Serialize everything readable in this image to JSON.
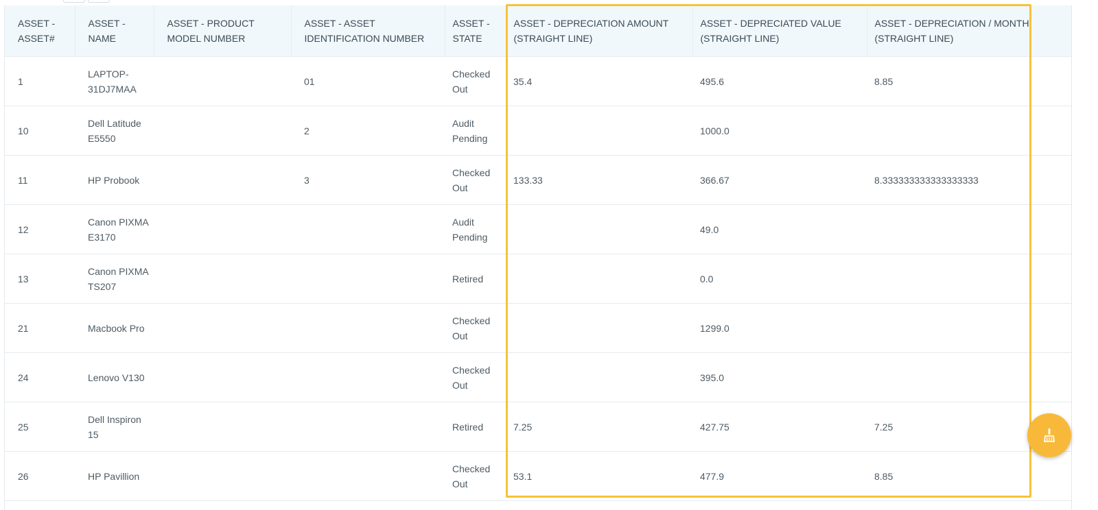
{
  "table": {
    "headers": [
      "ASSET - ASSET#",
      "ASSET - NAME",
      "ASSET - PRODUCT MODEL NUMBER",
      "ASSET - ASSET IDENTIFICATION NUMBER",
      "ASSET - STATE",
      "ASSET - DEPRECIATION AMOUNT (STRAIGHT LINE)",
      "ASSET - DEPRECIATED VALUE (STRAIGHT LINE)",
      "ASSET - DEPRECIATION / MONTH (STRAIGHT LINE)"
    ],
    "rows": [
      [
        "1",
        "LAPTOP-31DJ7MAA",
        "",
        "01",
        "Checked Out",
        "35.4",
        "495.6",
        "8.85"
      ],
      [
        "10",
        "Dell Latitude E5550",
        "",
        "2",
        "Audit Pending",
        "",
        "1000.0",
        ""
      ],
      [
        "11",
        "HP Probook",
        "",
        "3",
        "Checked Out",
        "133.33",
        "366.67",
        "8.333333333333333333"
      ],
      [
        "12",
        "Canon PIXMA E3170",
        "",
        "",
        "Audit Pending",
        "",
        "49.0",
        ""
      ],
      [
        "13",
        "Canon PIXMA TS207",
        "",
        "",
        "Retired",
        "",
        "0.0",
        ""
      ],
      [
        "21",
        "Macbook Pro",
        "",
        "",
        "Checked Out",
        "",
        "1299.0",
        ""
      ],
      [
        "24",
        "Lenovo V130",
        "",
        "",
        "Checked Out",
        "",
        "395.0",
        ""
      ],
      [
        "25",
        "Dell Inspiron 15",
        "",
        "",
        "Retired",
        "7.25",
        "427.75",
        "7.25"
      ],
      [
        "26",
        "HP Pavillion",
        "",
        "",
        "Checked Out",
        "53.1",
        "477.9",
        "8.85"
      ]
    ]
  },
  "fab": {
    "icon": "broom-icon",
    "color": "#f8b93a"
  },
  "highlight_color": "#f7c23b"
}
